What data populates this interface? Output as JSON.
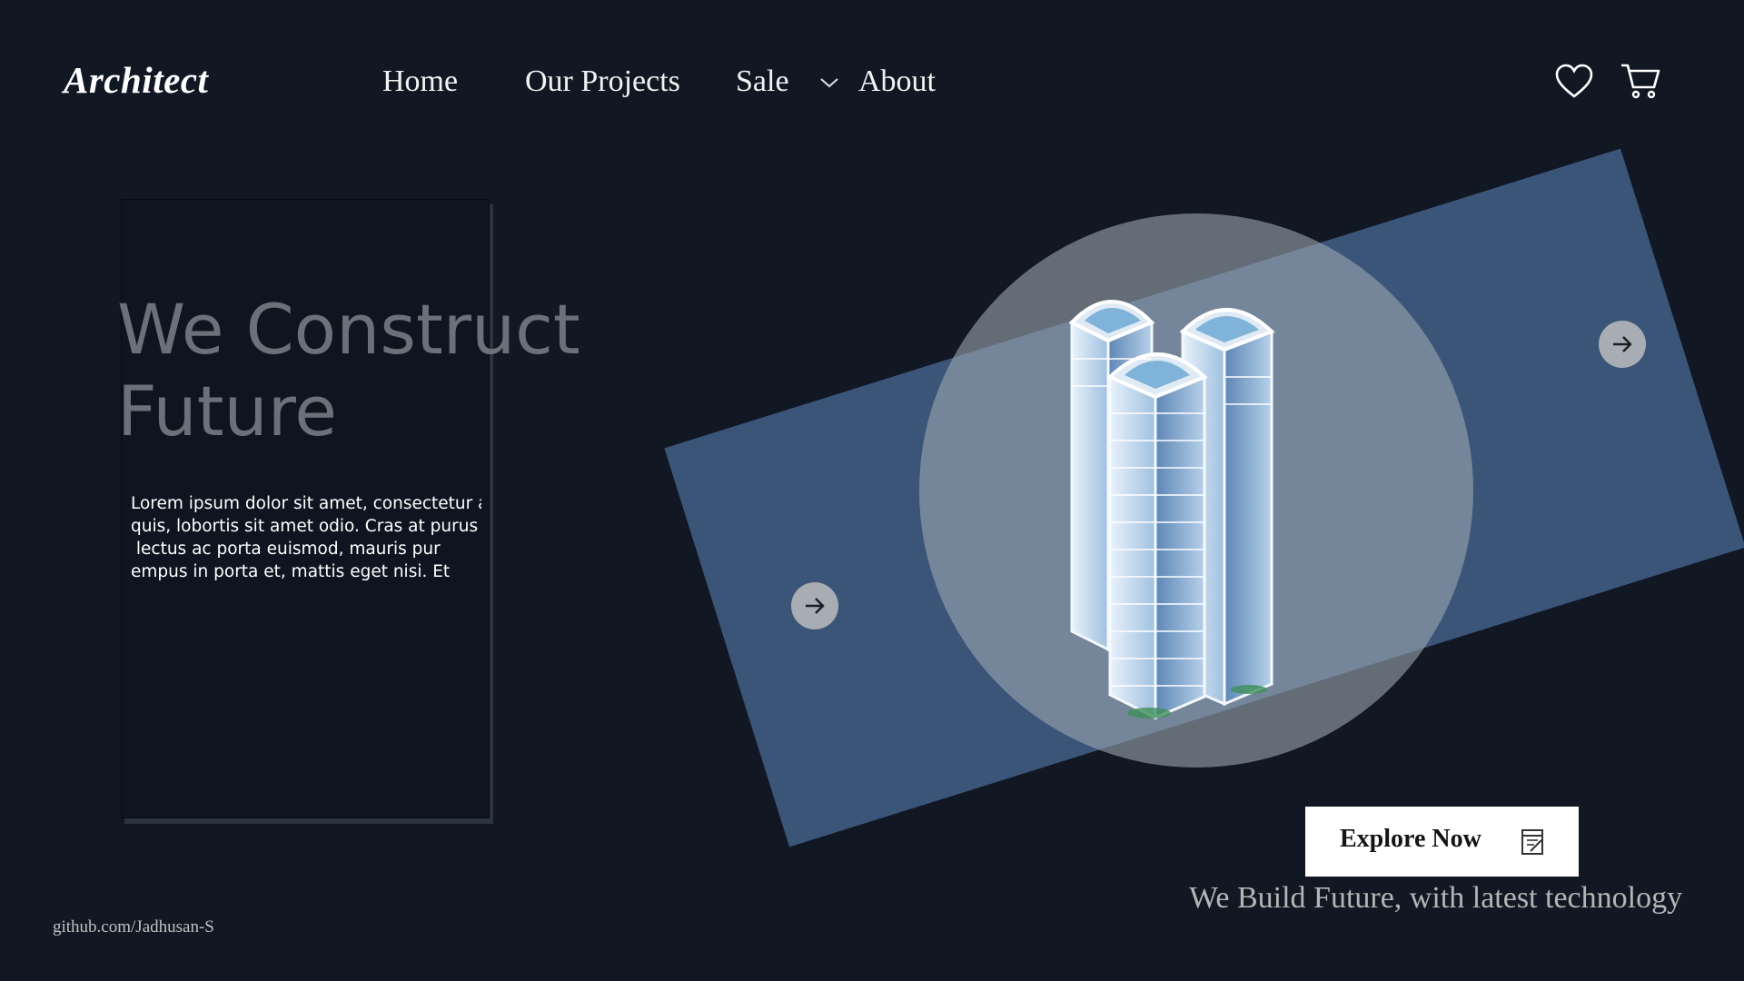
{
  "header": {
    "logo": "Architect",
    "nav": [
      {
        "label": "Home"
      },
      {
        "label": "Our Projects"
      },
      {
        "label": "Sale"
      },
      {
        "label": "About"
      }
    ],
    "icons": [
      "heart-icon",
      "cart-icon",
      "chevron-down-icon"
    ]
  },
  "hero": {
    "title_line1": "We Construct",
    "title_line2": "Future",
    "body_lines": [
      "Lorem ipsum dolor sit amet, consectetur ad",
      "quis, lobortis sit amet odio. Cras at purus v",
      " lectus ac porta euismod, mauris pur",
      "empus in porta et, mattis eget nisi. Et"
    ]
  },
  "showcase": {
    "image": "building-illustration",
    "controls": [
      "arrow-right-icon",
      "arrow-right-icon"
    ]
  },
  "cta": {
    "button_label": "Explore Now",
    "button_icon": "note-icon",
    "tagline": "We Build Future, with latest technology"
  },
  "footer": {
    "link": "github.com/Jadhusan-S"
  },
  "colors": {
    "background": "#111824",
    "slab": "#3b5579",
    "circle": "#a0aab4",
    "title": "#6c7079"
  }
}
